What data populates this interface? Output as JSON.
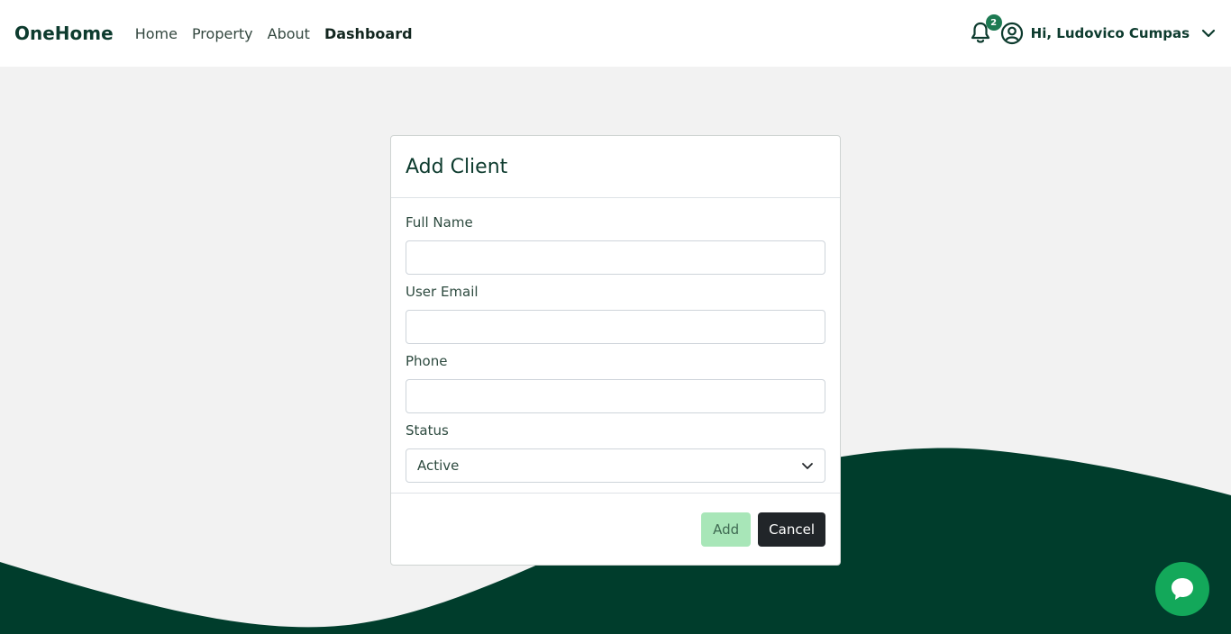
{
  "navbar": {
    "brand": "OneHome",
    "links": [
      {
        "label": "Home"
      },
      {
        "label": "Property"
      },
      {
        "label": "About"
      },
      {
        "label": "Dashboard"
      }
    ],
    "notification_count": "2",
    "greeting": "Hi, Ludovico Cumpas"
  },
  "modal": {
    "title": "Add Client",
    "fields": {
      "full_name": {
        "label": "Full Name",
        "value": ""
      },
      "email": {
        "label": "User Email",
        "value": ""
      },
      "phone": {
        "label": "Phone",
        "value": ""
      },
      "status": {
        "label": "Status",
        "value": "Active"
      }
    },
    "add_label": "Add",
    "cancel_label": "Cancel"
  },
  "colors": {
    "brand_green": "#0d3b2e",
    "wave_green": "#003d2c",
    "add_button": "#a8e6b8",
    "cancel_button": "#212529",
    "chat_button": "#13a85a",
    "badge": "#1d7a52"
  },
  "icons": {
    "notification": "bell-icon",
    "user": "user-circle-icon",
    "dropdown": "chevron-down-icon",
    "chat": "chat-bubble-icon"
  }
}
